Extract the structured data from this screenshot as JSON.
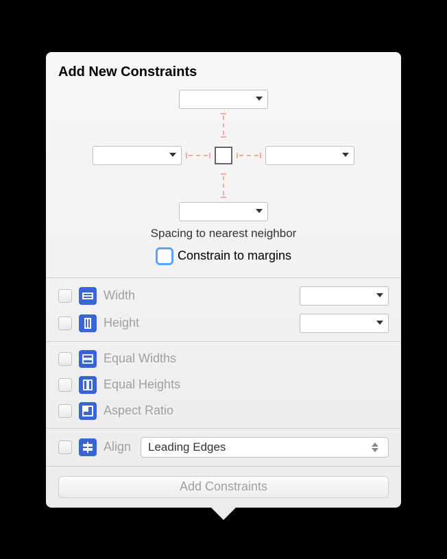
{
  "title": "Add New Constraints",
  "spacing": {
    "top": "",
    "leading": "",
    "trailing": "",
    "bottom": "",
    "caption": "Spacing to nearest neighbor",
    "constrain_margins_label": "Constrain to margins"
  },
  "size": {
    "width_label": "Width",
    "width_value": "",
    "height_label": "Height",
    "height_value": ""
  },
  "equal": {
    "widths_label": "Equal Widths",
    "heights_label": "Equal Heights",
    "aspect_label": "Aspect Ratio"
  },
  "align": {
    "label": "Align",
    "selected": "Leading Edges"
  },
  "footer": {
    "button_label": "Add Constraints"
  }
}
